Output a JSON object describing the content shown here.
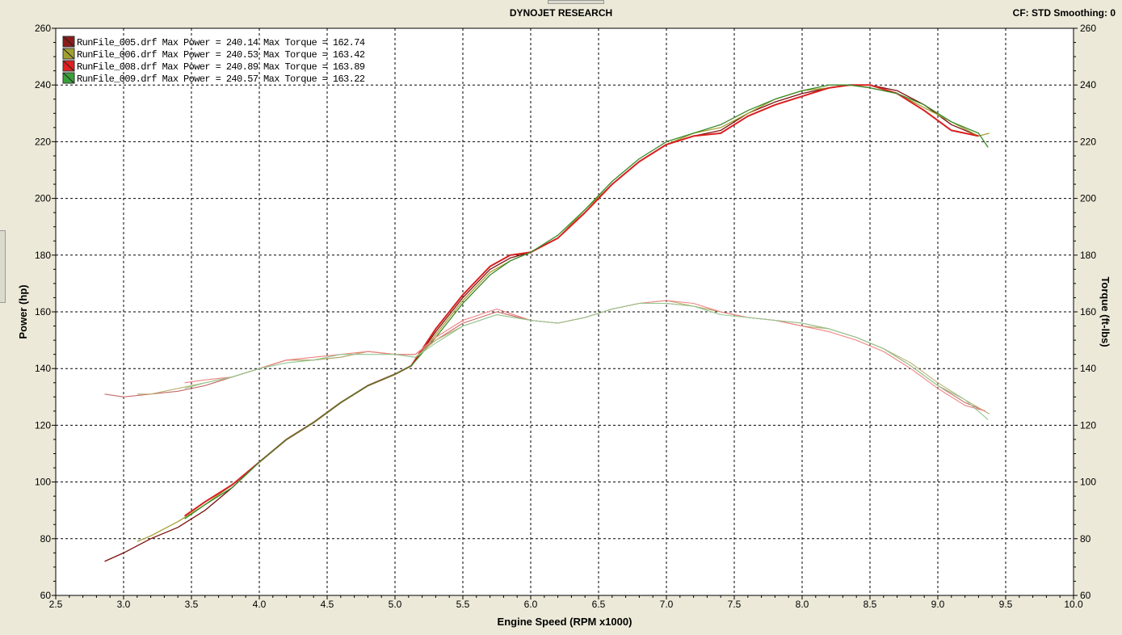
{
  "header": {
    "title": "DYNOJET RESEARCH",
    "cf_smoothing": "CF: STD  Smoothing: 0"
  },
  "chart_data": {
    "type": "line",
    "title": "DYNOJET RESEARCH",
    "xlabel": "Engine Speed (RPM x1000)",
    "ylabel_left": "Power (hp)",
    "ylabel_right": "Torque (ft-lbs)",
    "xlim": [
      2.5,
      10.0
    ],
    "ylim": [
      60,
      260
    ],
    "x_ticks": [
      "2.5",
      "3.0",
      "3.5",
      "4.0",
      "4.5",
      "5.0",
      "5.5",
      "6.0",
      "6.5",
      "7.0",
      "7.5",
      "8.0",
      "8.5",
      "9.0",
      "9.5",
      "10.0"
    ],
    "y_ticks": [
      "60",
      "80",
      "100",
      "120",
      "140",
      "160",
      "180",
      "200",
      "220",
      "240",
      "260"
    ],
    "grid": true,
    "legend_position": "top-left",
    "legend": [
      {
        "text": "RunFile_005.drf Max Power = 240.14 Max Torque = 162.74",
        "color": "#8b1a1a"
      },
      {
        "text": "RunFile_006.drf Max Power = 240.53 Max Torque = 163.42",
        "color": "#a3a032"
      },
      {
        "text": "RunFile_008.drf Max Power = 240.89 Max Torque = 163.89",
        "color": "#e02020"
      },
      {
        "text": "RunFile_009.drf Max Power = 240.57 Max Torque = 163.22",
        "color": "#3aa03a"
      }
    ],
    "series": [
      {
        "name": "RunFile_005.drf",
        "kind": "power",
        "color": "#7a1010",
        "x": [
          2.86,
          3.0,
          3.2,
          3.4,
          3.6,
          3.8,
          4.0,
          4.2,
          4.4,
          4.6,
          4.8,
          5.0,
          5.12,
          5.3,
          5.5,
          5.7,
          5.85,
          6.0,
          6.2,
          6.4,
          6.6,
          6.8,
          7.0,
          7.2,
          7.4,
          7.6,
          7.8,
          8.0,
          8.2,
          8.35,
          8.5,
          8.7,
          8.9,
          9.1,
          9.3
        ],
        "y": [
          72,
          75,
          80,
          84,
          90,
          98,
          107,
          115,
          121,
          128,
          134,
          138,
          141,
          153,
          165,
          175,
          179,
          181,
          186,
          195,
          205,
          213,
          219,
          222,
          224,
          230,
          234,
          237,
          239,
          240,
          240,
          238,
          233,
          226,
          222
        ]
      },
      {
        "name": "RunFile_006.drf",
        "kind": "power",
        "color": "#a3a032",
        "x": [
          3.1,
          3.2,
          3.4,
          3.6,
          3.8,
          4.0,
          4.2,
          4.4,
          4.6,
          4.8,
          5.0,
          5.12,
          5.3,
          5.5,
          5.7,
          5.85,
          6.0,
          6.2,
          6.4,
          6.6,
          6.8,
          7.0,
          7.2,
          7.4,
          7.6,
          7.8,
          8.0,
          8.2,
          8.35,
          8.5,
          8.7,
          8.9,
          9.1,
          9.3,
          9.38
        ],
        "y": [
          79,
          81,
          86,
          92,
          99,
          107,
          115,
          121,
          128,
          134,
          138,
          141,
          152,
          164,
          174,
          178,
          181,
          186,
          196,
          205,
          213,
          219,
          223,
          225,
          230,
          235,
          238,
          239,
          240,
          239,
          237,
          232,
          227,
          222,
          223
        ]
      },
      {
        "name": "RunFile_008.drf",
        "kind": "power",
        "color": "#d82020",
        "x": [
          3.45,
          3.6,
          3.8,
          4.0,
          4.2,
          4.4,
          4.6,
          4.8,
          5.0,
          5.12,
          5.3,
          5.5,
          5.7,
          5.85,
          6.0,
          6.2,
          6.4,
          6.6,
          6.8,
          7.0,
          7.2,
          7.4,
          7.6,
          7.8,
          8.0,
          8.2,
          8.35,
          8.5,
          8.7,
          8.9,
          9.1,
          9.3
        ],
        "y": [
          88,
          93,
          99,
          107,
          115,
          121,
          128,
          134,
          138,
          141,
          154,
          166,
          176,
          180,
          181,
          186,
          195,
          205,
          213,
          219,
          222,
          223,
          229,
          233,
          236,
          239,
          240,
          240,
          237,
          231,
          224,
          222
        ]
      },
      {
        "name": "RunFile_009.drf",
        "kind": "power",
        "color": "#3a8a2a",
        "x": [
          3.45,
          3.6,
          3.8,
          4.0,
          4.2,
          4.4,
          4.6,
          4.8,
          5.0,
          5.12,
          5.3,
          5.5,
          5.7,
          5.85,
          6.0,
          6.2,
          6.4,
          6.6,
          6.8,
          7.0,
          7.2,
          7.4,
          7.6,
          7.8,
          8.0,
          8.2,
          8.35,
          8.5,
          8.7,
          8.9,
          9.1,
          9.3,
          9.37
        ],
        "y": [
          87,
          92,
          98,
          107,
          115,
          121,
          128,
          134,
          138,
          141,
          151,
          163,
          173,
          178,
          181,
          187,
          196,
          206,
          214,
          220,
          223,
          226,
          231,
          235,
          238,
          240,
          240,
          239,
          237,
          233,
          227,
          223,
          218
        ]
      },
      {
        "name": "RunFile_005.drf",
        "kind": "torque",
        "color": "#c86a6a",
        "x": [
          2.86,
          3.0,
          3.2,
          3.4,
          3.6,
          3.8,
          4.0,
          4.2,
          4.4,
          4.6,
          4.8,
          5.0,
          5.15,
          5.3,
          5.5,
          5.75,
          6.0,
          6.2,
          6.4,
          6.6,
          6.8,
          7.0,
          7.2,
          7.4,
          7.6,
          7.8,
          8.0,
          8.2,
          8.4,
          8.6,
          8.8,
          9.0,
          9.2,
          9.35
        ],
        "y": [
          131,
          130,
          131,
          132,
          134,
          137,
          140,
          143,
          143,
          144,
          146,
          145,
          145,
          150,
          156,
          160,
          157,
          156,
          158,
          161,
          163,
          163,
          162,
          160,
          158,
          157,
          156,
          154,
          151,
          147,
          141,
          134,
          128,
          125
        ]
      },
      {
        "name": "RunFile_006.drf",
        "kind": "torque",
        "color": "#b8b070",
        "x": [
          3.1,
          3.2,
          3.4,
          3.6,
          3.8,
          4.0,
          4.2,
          4.4,
          4.6,
          4.8,
          5.0,
          5.15,
          5.3,
          5.5,
          5.75,
          6.0,
          6.2,
          6.4,
          6.6,
          6.8,
          7.0,
          7.2,
          7.4,
          7.6,
          7.8,
          8.0,
          8.2,
          8.4,
          8.6,
          8.8,
          9.0,
          9.2,
          9.38
        ],
        "y": [
          131,
          131,
          133,
          135,
          137,
          140,
          143,
          143,
          144,
          146,
          145,
          144,
          150,
          155,
          159,
          157,
          156,
          158,
          161,
          163,
          164,
          162,
          160,
          158,
          157,
          155,
          154,
          151,
          147,
          142,
          135,
          129,
          124
        ]
      },
      {
        "name": "RunFile_008.drf",
        "kind": "torque",
        "color": "#f08080",
        "x": [
          3.45,
          3.6,
          3.8,
          4.0,
          4.2,
          4.4,
          4.6,
          4.8,
          5.0,
          5.15,
          5.3,
          5.5,
          5.75,
          6.0,
          6.2,
          6.4,
          6.6,
          6.8,
          7.0,
          7.2,
          7.4,
          7.6,
          7.8,
          8.0,
          8.2,
          8.4,
          8.6,
          8.8,
          9.0,
          9.2,
          9.35
        ],
        "y": [
          135,
          136,
          137,
          140,
          143,
          144,
          145,
          146,
          145,
          145,
          151,
          157,
          161,
          157,
          156,
          158,
          161,
          163,
          164,
          163,
          160,
          158,
          157,
          155,
          153,
          150,
          146,
          140,
          133,
          127,
          125
        ]
      },
      {
        "name": "RunFile_009.drf",
        "kind": "torque",
        "color": "#90c890",
        "x": [
          3.45,
          3.6,
          3.8,
          4.0,
          4.2,
          4.4,
          4.6,
          4.8,
          5.0,
          5.15,
          5.3,
          5.5,
          5.75,
          6.0,
          6.2,
          6.4,
          6.6,
          6.8,
          7.0,
          7.2,
          7.4,
          7.6,
          7.8,
          8.0,
          8.2,
          8.4,
          8.6,
          8.8,
          9.0,
          9.2,
          9.37
        ],
        "y": [
          133,
          135,
          137,
          140,
          142,
          143,
          145,
          145,
          145,
          144,
          149,
          155,
          159,
          157,
          156,
          158,
          161,
          163,
          163,
          162,
          159,
          158,
          157,
          156,
          154,
          151,
          147,
          141,
          134,
          129,
          122
        ]
      }
    ]
  }
}
